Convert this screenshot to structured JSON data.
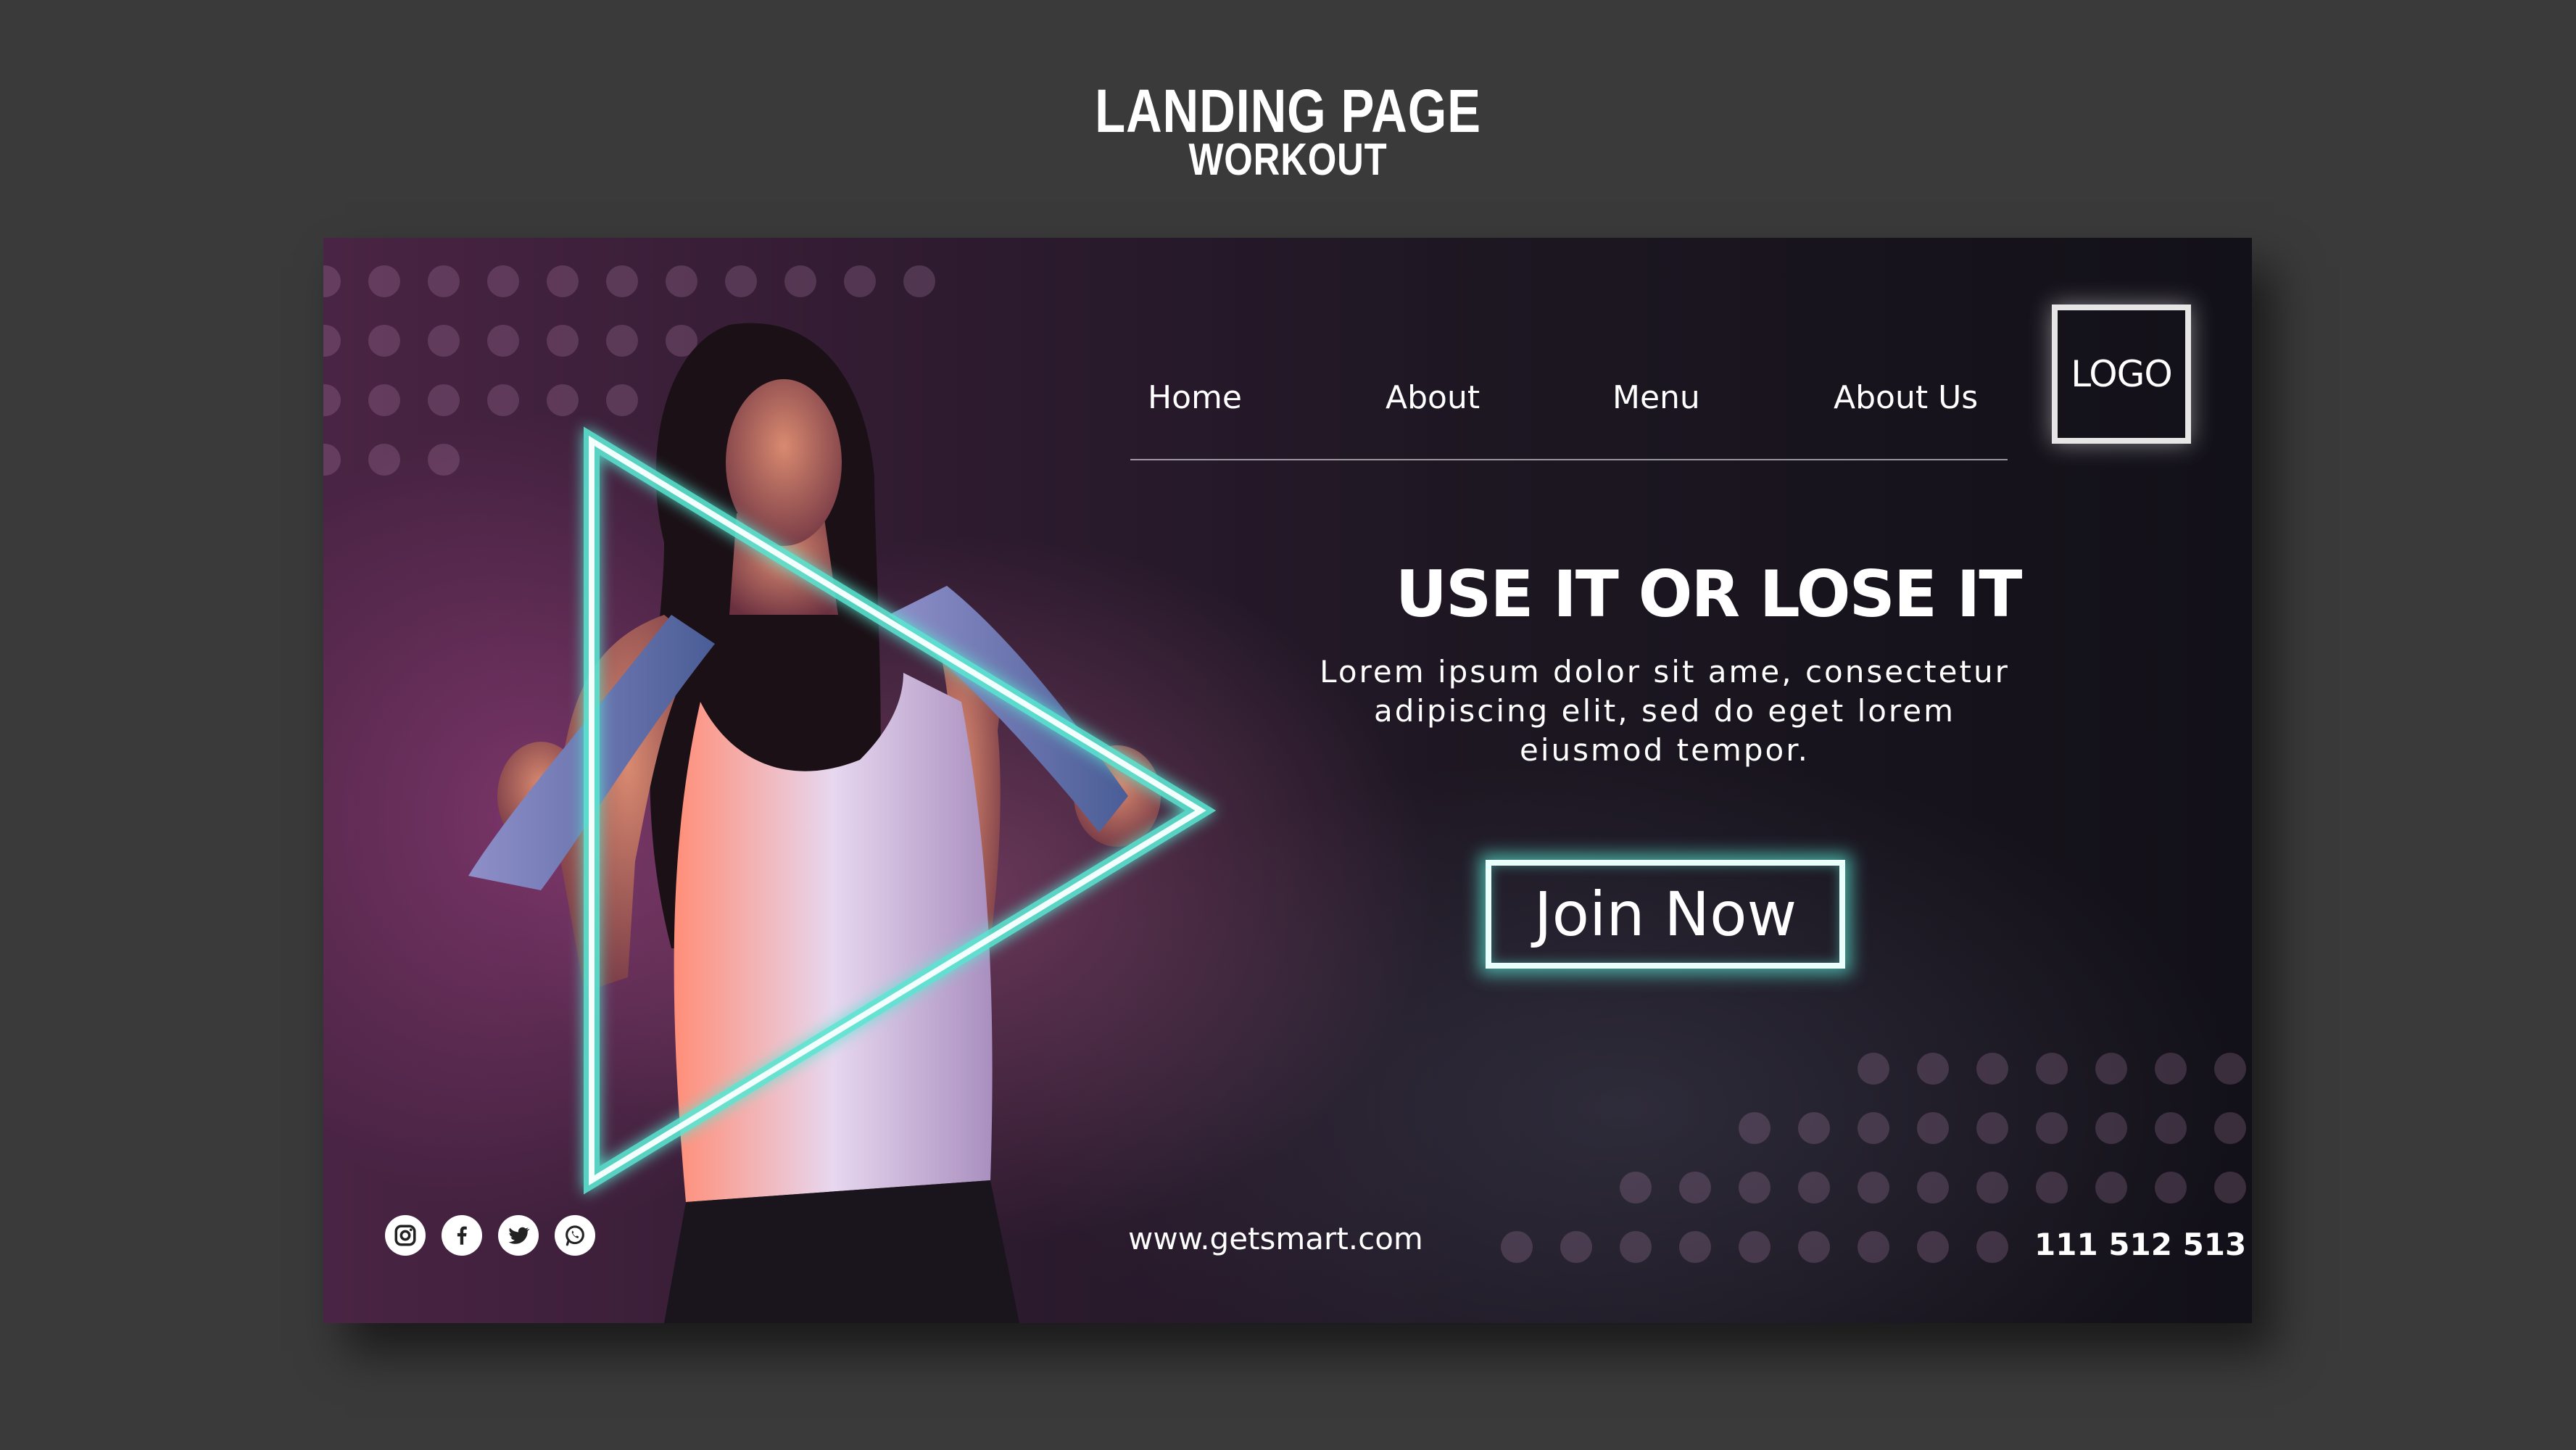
{
  "header": {
    "title": "LANDING PAGE",
    "subtitle": "WORKOUT"
  },
  "nav": {
    "items": [
      {
        "label": "Home"
      },
      {
        "label": "About"
      },
      {
        "label": "Menu"
      },
      {
        "label": "About Us"
      }
    ]
  },
  "logo": {
    "text": "LOGO"
  },
  "hero": {
    "headline": "USE IT OR LOSE IT",
    "body": "Lorem ipsum dolor sit ame, consectetur adipiscing elit, sed do eget lorem eiusmod tempor.",
    "cta_label": "Join Now"
  },
  "footer": {
    "website": "www.getsmart.com",
    "phone": "111 512 513",
    "social": [
      "instagram-icon",
      "facebook-icon",
      "twitter-icon",
      "whatsapp-icon"
    ]
  },
  "colors": {
    "page_background": "#3a3a3a",
    "neon_accent": "#5ae6d2",
    "text": "#ffffff"
  }
}
